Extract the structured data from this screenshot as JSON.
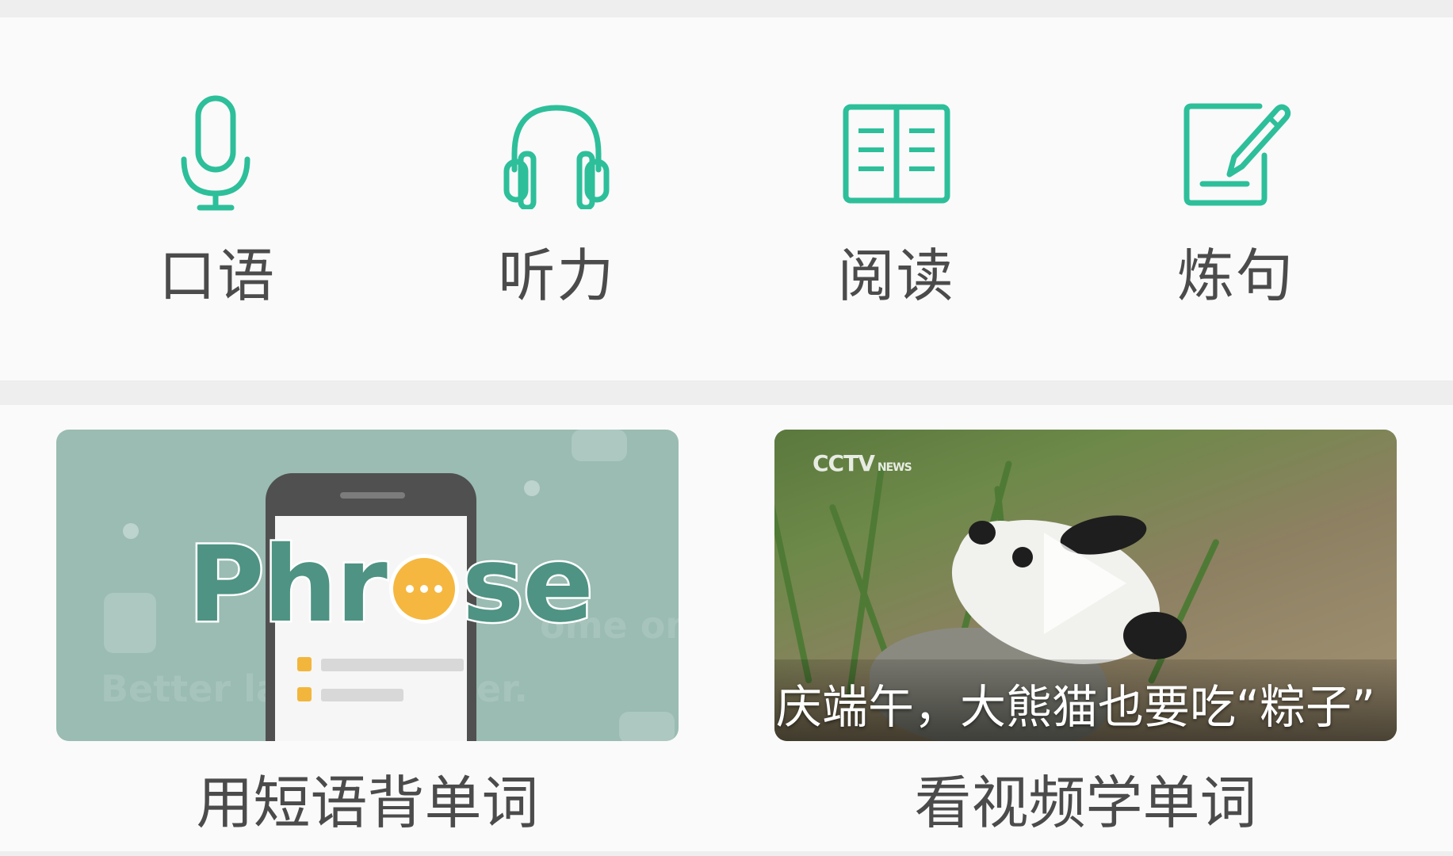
{
  "features": [
    {
      "label": "口语",
      "icon": "microphone-icon"
    },
    {
      "label": "听力",
      "icon": "headphones-icon"
    },
    {
      "label": "阅读",
      "icon": "book-icon"
    },
    {
      "label": "炼句",
      "icon": "edit-pencil-icon"
    }
  ],
  "accent_color": "#2dbf9a",
  "cards": {
    "phrase": {
      "caption": "用短语背单词",
      "image_word": "Phrase",
      "bg_text_1": "Better la",
      "bg_text_2": "er.",
      "bg_text_3": "ome on"
    },
    "video": {
      "caption": "看视频学单词",
      "title": "庆端午，大熊猫也要吃“粽子”",
      "logo": "CCTV",
      "logo_sub": "NEWS"
    }
  }
}
